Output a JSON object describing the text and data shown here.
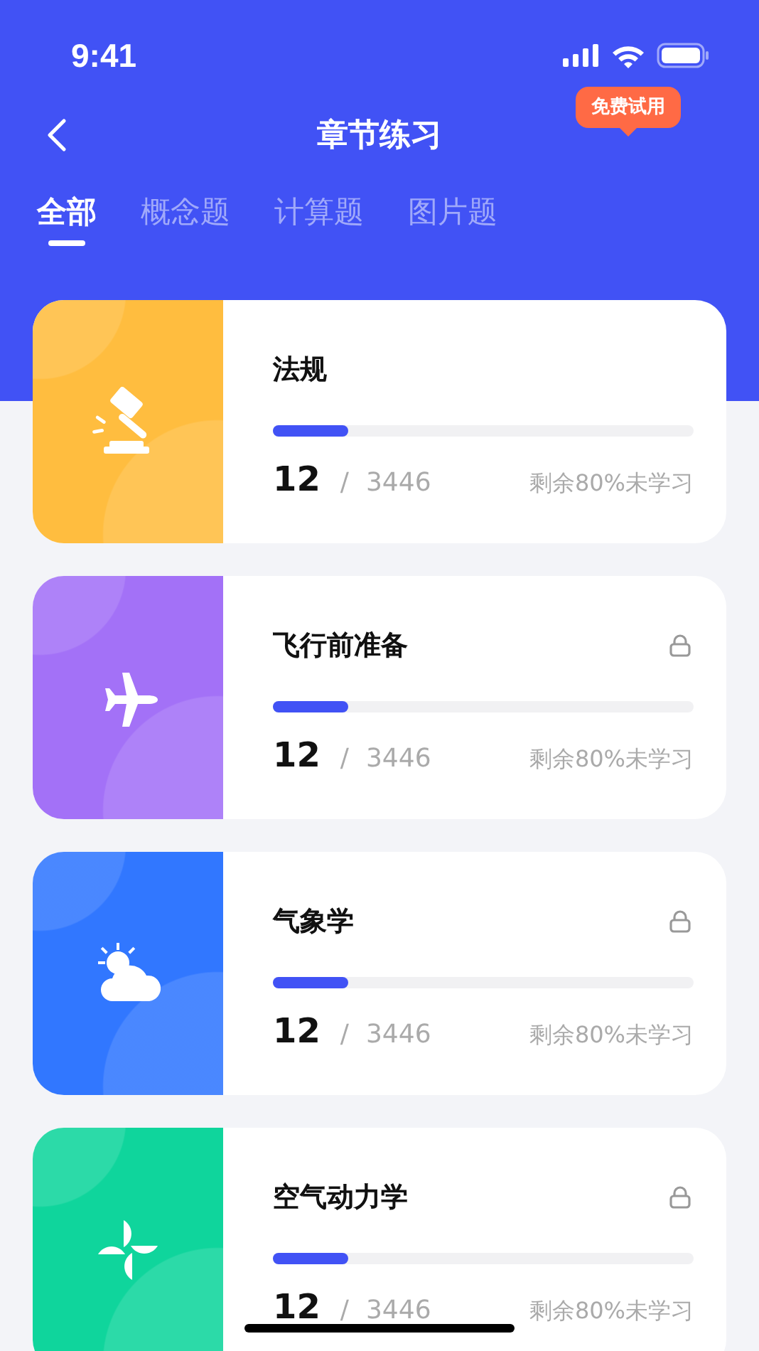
{
  "status_bar": {
    "time": "9:41"
  },
  "nav": {
    "title": "章节练习",
    "badge": "免费试用"
  },
  "tabs": [
    {
      "label": "全部",
      "selected": true
    },
    {
      "label": "概念题",
      "selected": false
    },
    {
      "label": "计算题",
      "selected": false
    },
    {
      "label": "图片题",
      "selected": false
    }
  ],
  "chapters": [
    {
      "kind": "gavel",
      "color": "#ffbd3f",
      "title": "法规",
      "locked": false,
      "level": 0.18,
      "done": "12",
      "separator": "/",
      "total": "3446",
      "remaining": "剩余80%未学习"
    },
    {
      "kind": "plane",
      "color": "#a371f7",
      "title": "飞行前准备",
      "locked": true,
      "level": 0.18,
      "done": "12",
      "separator": "/",
      "total": "3446",
      "remaining": "剩余80%未学习"
    },
    {
      "kind": "weather",
      "color": "#3177ff",
      "title": "气象学",
      "locked": true,
      "level": 0.18,
      "done": "12",
      "separator": "/",
      "total": "3446",
      "remaining": "剩余80%未学习"
    },
    {
      "kind": "fan",
      "color": "#0fd59c",
      "title": "空气动力学",
      "locked": true,
      "level": 0.18,
      "done": "12",
      "separator": "/",
      "total": "3446",
      "remaining": "剩余80%未学习"
    }
  ]
}
